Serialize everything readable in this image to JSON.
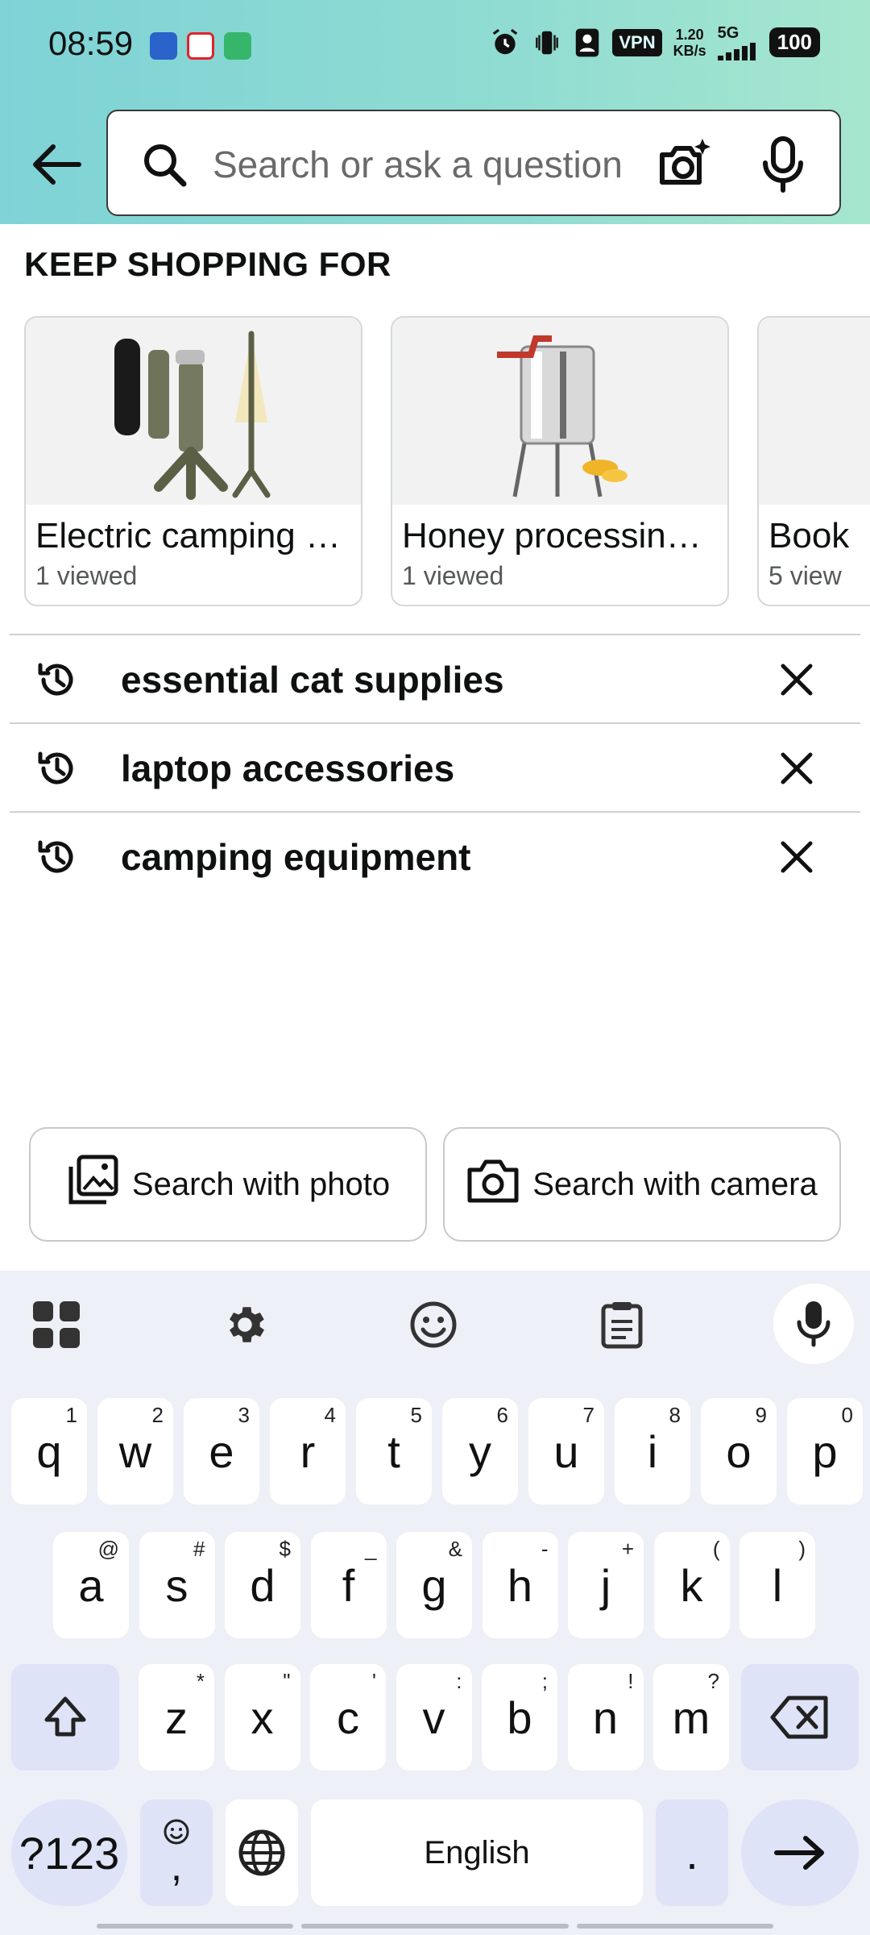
{
  "status_bar": {
    "time": "08:59",
    "vpn": "VPN",
    "speed_value": "1.20",
    "speed_unit": "KB/s",
    "network": "5G",
    "battery": "100"
  },
  "search": {
    "placeholder": "Search or ask a question"
  },
  "keep_shopping": {
    "title": "KEEP SHOPPING FOR",
    "items": [
      {
        "title": "Electric camping …",
        "subtitle": "1 viewed"
      },
      {
        "title": "Honey processin…",
        "subtitle": "1 viewed"
      },
      {
        "title": "Book",
        "subtitle": "5 view"
      }
    ]
  },
  "history": [
    {
      "label": "essential cat supplies"
    },
    {
      "label": "laptop accessories"
    },
    {
      "label": "camping equipment"
    }
  ],
  "buttons": {
    "search_with_photo": "Search with photo",
    "search_with_camera": "Search with camera"
  },
  "keyboard": {
    "row1": [
      {
        "k": "q",
        "h": "1"
      },
      {
        "k": "w",
        "h": "2"
      },
      {
        "k": "e",
        "h": "3"
      },
      {
        "k": "r",
        "h": "4"
      },
      {
        "k": "t",
        "h": "5"
      },
      {
        "k": "y",
        "h": "6"
      },
      {
        "k": "u",
        "h": "7"
      },
      {
        "k": "i",
        "h": "8"
      },
      {
        "k": "o",
        "h": "9"
      },
      {
        "k": "p",
        "h": "0"
      }
    ],
    "row2": [
      {
        "k": "a",
        "h": "@"
      },
      {
        "k": "s",
        "h": "#"
      },
      {
        "k": "d",
        "h": "$"
      },
      {
        "k": "f",
        "h": "_"
      },
      {
        "k": "g",
        "h": "&"
      },
      {
        "k": "h",
        "h": "-"
      },
      {
        "k": "j",
        "h": "+"
      },
      {
        "k": "k",
        "h": "("
      },
      {
        "k": "l",
        "h": ")"
      }
    ],
    "row3": [
      {
        "k": "z",
        "h": "*"
      },
      {
        "k": "x",
        "h": "\""
      },
      {
        "k": "c",
        "h": "'"
      },
      {
        "k": "v",
        "h": ":"
      },
      {
        "k": "b",
        "h": ";"
      },
      {
        "k": "n",
        "h": "!"
      },
      {
        "k": "m",
        "h": "?"
      }
    ],
    "symbols": "?123",
    "comma": ",",
    "space": "English",
    "period": "."
  }
}
